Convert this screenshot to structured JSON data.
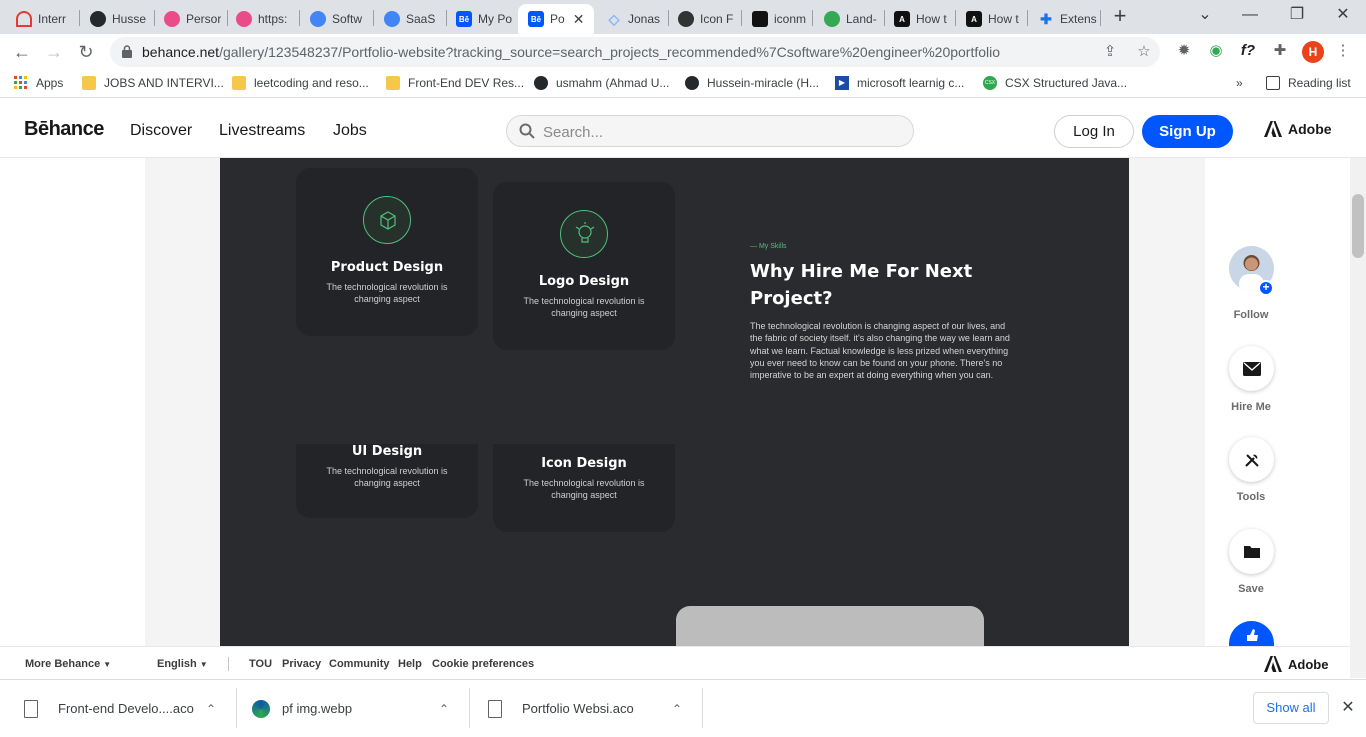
{
  "tabs": [
    {
      "label": "Interr",
      "icon": "speedometer-icon",
      "color": "#e53935"
    },
    {
      "label": "Husse",
      "icon": "github-icon",
      "color": "#24292e"
    },
    {
      "label": "Persor",
      "icon": "dribbble-icon",
      "color": "#ea4c89"
    },
    {
      "label": "https:",
      "icon": "dribbble-icon",
      "color": "#ea4c89"
    },
    {
      "label": "Softw",
      "icon": "search-icon",
      "color": "#4285f4"
    },
    {
      "label": "SaaS",
      "icon": "search-icon",
      "color": "#4285f4"
    },
    {
      "label": "My Po",
      "icon": "behance-icon",
      "color": "#0057ff"
    },
    {
      "label": "Po",
      "icon": "behance-icon",
      "color": "#0057ff"
    },
    {
      "label": "Jonas",
      "icon": "diamond-icon",
      "color": "#8ab4f8"
    },
    {
      "label": "Icon F",
      "icon": "iconfinder-icon",
      "color": "#333333"
    },
    {
      "label": "iconm",
      "icon": "iconmonstr-icon",
      "color": "#111111"
    },
    {
      "label": "Land-",
      "icon": "globe-icon",
      "color": "#34a853"
    },
    {
      "label": "How t",
      "icon": "nextjs-icon",
      "color": "#111111"
    },
    {
      "label": "How t",
      "icon": "nextjs-icon",
      "color": "#111111"
    },
    {
      "label": "Extens",
      "icon": "puzzle-icon",
      "color": "#1a73e8"
    }
  ],
  "url": {
    "host": "behance.net",
    "path": "/gallery/123548237/Portfolio-website?tracking_source=search_projects_recommended%7Csoftware%20engineer%20portfolio"
  },
  "profile_initial": "H",
  "bookmarks": [
    {
      "label": "Apps",
      "icon": "apps-grid-icon"
    },
    {
      "label": "JOBS AND INTERVI...",
      "icon": "folder-icon"
    },
    {
      "label": "leetcoding and reso...",
      "icon": "folder-icon"
    },
    {
      "label": "Front-End DEV Res...",
      "icon": "folder-icon"
    },
    {
      "label": "usmahm (Ahmad U...",
      "icon": "github-icon"
    },
    {
      "label": "Hussein-miracle (H...",
      "icon": "github-icon"
    },
    {
      "label": "microsoft learnig c...",
      "icon": "play-icon"
    },
    {
      "label": "CSX Structured Java...",
      "icon": "csx-icon"
    }
  ],
  "reading_list": "Reading list",
  "behance": {
    "logo": "Bēhance",
    "nav": [
      "Discover",
      "Livestreams",
      "Jobs"
    ],
    "search_placeholder": "Search...",
    "login": "Log In",
    "signup": "Sign Up",
    "adobe": "Adobe"
  },
  "artwork": {
    "cards": [
      {
        "title": "Product Design",
        "desc": "The technological revolution is changing aspect"
      },
      {
        "title": "Logo Design",
        "desc": "The technological revolution is changing aspect"
      },
      {
        "title": "UI Design",
        "desc": "The technological revolution is changing aspect"
      },
      {
        "title": "Icon Design",
        "desc": "The technological revolution is changing aspect"
      }
    ],
    "skills_tag": "— My Skills",
    "heading": "Why Hire Me For Next Project?",
    "paragraph": "The technological revolution is changing aspect of our lives, and the fabric of society itself. it's also changing the way we learn and what we learn. Factual knowledge is less prized when everything you ever need to know can be found on your phone. There's no imperative to be an expert at doing everything when you can."
  },
  "actions": [
    "Follow",
    "Hire Me",
    "Tools",
    "Save"
  ],
  "footer": {
    "more": "More Behance",
    "language": "English",
    "links": [
      "TOU",
      "Privacy",
      "Community",
      "Help",
      "Cookie preferences"
    ],
    "adobe": "Adobe"
  },
  "downloads": [
    {
      "name": "Front-end Develo....aco",
      "icon": "file-icon"
    },
    {
      "name": "pf img.webp",
      "icon": "edge-icon"
    },
    {
      "name": "Portfolio Websi.aco",
      "icon": "file-icon"
    }
  ],
  "show_all": "Show all"
}
